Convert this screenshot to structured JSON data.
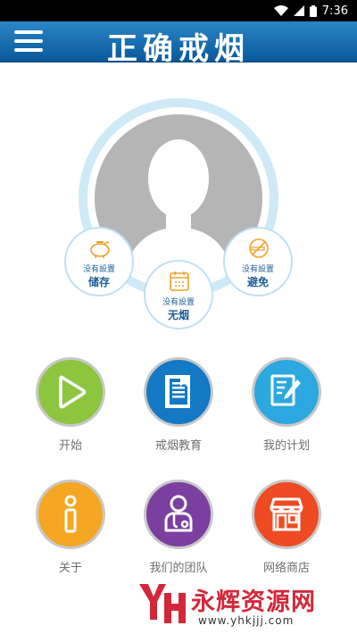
{
  "status_bar": {
    "time": "7:36",
    "icons": [
      "wifi-icon",
      "signal-icon",
      "battery-icon"
    ]
  },
  "header": {
    "title": "正确戒烟",
    "menu_icon": "hamburger-menu-icon"
  },
  "profile": {
    "avatar_icon": "default-user-silhouette",
    "stats": [
      {
        "icon": "piggy-bank-icon",
        "value_text": "没有設置",
        "name": "储存"
      },
      {
        "icon": "calendar-icon",
        "value_text": "没有設置",
        "name": "无烟"
      },
      {
        "icon": "no-smoking-icon",
        "value_text": "没有設置",
        "name": "避免"
      }
    ]
  },
  "tiles": [
    {
      "label": "开始",
      "icon": "play-icon",
      "color": "#8cc63f"
    },
    {
      "label": "戒烟教育",
      "icon": "book-icon",
      "color": "#1479c4"
    },
    {
      "label": "我的计划",
      "icon": "plan-edit-icon",
      "color": "#2da7e0"
    },
    {
      "label": "关于",
      "icon": "info-icon",
      "color": "#f5a623"
    },
    {
      "label": "我们的团队",
      "icon": "team-doctor-icon",
      "color": "#7b3fa0"
    },
    {
      "label": "网络商店",
      "icon": "store-icon",
      "color": "#ef4b23"
    }
  ],
  "watermark": {
    "name": "永辉资源网",
    "url": "www.yhkjjj.com"
  },
  "colors": {
    "header": "#1a6fb3",
    "accent_text": "#1e5f99",
    "watermark": "#d3283a"
  }
}
